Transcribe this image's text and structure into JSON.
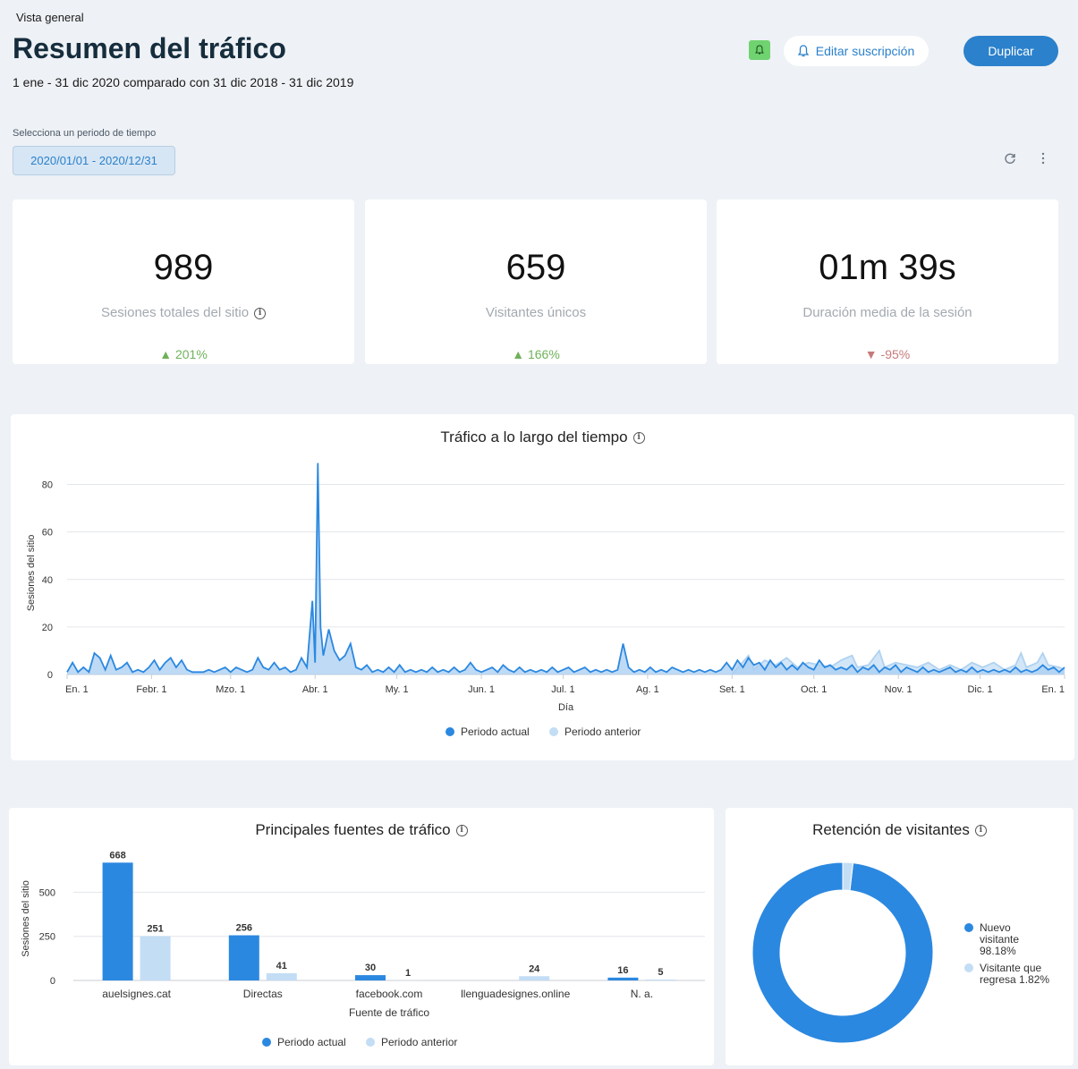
{
  "header": {
    "breadcrumb": "Vista general",
    "title": "Resumen del tráfico",
    "subtitle": "1 ene - 31 dic 2020 comparado con 31 dic 2018 - 31 dic 2019",
    "edit_subscription_label": "Editar suscripción",
    "duplicate_label": "Duplicar"
  },
  "period": {
    "label": "Selecciona un periodo de tiempo",
    "value": "2020/01/01 - 2020/12/31"
  },
  "kpis": [
    {
      "value": "989",
      "label": "Sesiones totales del sitio",
      "delta": "▲ 201%",
      "trend": "up"
    },
    {
      "value": "659",
      "label": "Visitantes únicos",
      "delta": "▲ 166%",
      "trend": "up"
    },
    {
      "value": "01m 39s",
      "label": "Duración media de la sesión",
      "delta": "▼ -95%",
      "trend": "down"
    }
  ],
  "colors": {
    "current": "#2b88e0",
    "previous": "#c3ddf5",
    "accent": "#2b81cb"
  },
  "chart_data": [
    {
      "type": "area",
      "title": "Tráfico a lo largo del tiempo",
      "xlabel": "Día",
      "ylabel": "Sesiones del sitio",
      "ylim": [
        0,
        90
      ],
      "yticks": [
        0,
        20,
        40,
        60,
        80
      ],
      "xticks": [
        "En. 1",
        "Febr. 1",
        "Mzo. 1",
        "Abr. 1",
        "My. 1",
        "Jun. 1",
        "Jul. 1",
        "Ag. 1",
        "Set. 1",
        "Oct. 1",
        "Nov. 1",
        "Dic. 1",
        "En. 1"
      ],
      "legend": "bottom",
      "series": [
        {
          "name": "Periodo actual",
          "points": [
            [
              0,
              1
            ],
            [
              2,
              5
            ],
            [
              4,
              1
            ],
            [
              6,
              3
            ],
            [
              8,
              1
            ],
            [
              10,
              9
            ],
            [
              12,
              7
            ],
            [
              14,
              2
            ],
            [
              16,
              8
            ],
            [
              18,
              2
            ],
            [
              20,
              3
            ],
            [
              22,
              5
            ],
            [
              24,
              1
            ],
            [
              26,
              2
            ],
            [
              28,
              1
            ],
            [
              30,
              3
            ],
            [
              32,
              6
            ],
            [
              34,
              2
            ],
            [
              36,
              5
            ],
            [
              38,
              7
            ],
            [
              40,
              3
            ],
            [
              42,
              6
            ],
            [
              44,
              2
            ],
            [
              46,
              1
            ],
            [
              48,
              1
            ],
            [
              50,
              1
            ],
            [
              52,
              2
            ],
            [
              54,
              1
            ],
            [
              56,
              2
            ],
            [
              58,
              3
            ],
            [
              60,
              1
            ],
            [
              62,
              3
            ],
            [
              64,
              2
            ],
            [
              66,
              1
            ],
            [
              68,
              2
            ],
            [
              70,
              7
            ],
            [
              72,
              3
            ],
            [
              74,
              2
            ],
            [
              76,
              5
            ],
            [
              78,
              2
            ],
            [
              80,
              3
            ],
            [
              82,
              1
            ],
            [
              84,
              2
            ],
            [
              86,
              7
            ],
            [
              88,
              3
            ],
            [
              90,
              31
            ],
            [
              91,
              5
            ],
            [
              92,
              89
            ],
            [
              93,
              20
            ],
            [
              94,
              8
            ],
            [
              96,
              19
            ],
            [
              98,
              10
            ],
            [
              100,
              6
            ],
            [
              102,
              8
            ],
            [
              104,
              13
            ],
            [
              106,
              3
            ],
            [
              108,
              2
            ],
            [
              110,
              4
            ],
            [
              112,
              1
            ],
            [
              114,
              2
            ],
            [
              116,
              1
            ],
            [
              118,
              3
            ],
            [
              120,
              1
            ],
            [
              122,
              4
            ],
            [
              124,
              1
            ],
            [
              126,
              2
            ],
            [
              128,
              1
            ],
            [
              130,
              2
            ],
            [
              132,
              1
            ],
            [
              134,
              3
            ],
            [
              136,
              1
            ],
            [
              138,
              2
            ],
            [
              140,
              1
            ],
            [
              142,
              3
            ],
            [
              144,
              1
            ],
            [
              146,
              2
            ],
            [
              148,
              5
            ],
            [
              150,
              2
            ],
            [
              152,
              1
            ],
            [
              154,
              2
            ],
            [
              156,
              3
            ],
            [
              158,
              1
            ],
            [
              160,
              4
            ],
            [
              162,
              2
            ],
            [
              164,
              1
            ],
            [
              166,
              3
            ],
            [
              168,
              1
            ],
            [
              170,
              2
            ],
            [
              172,
              1
            ],
            [
              174,
              2
            ],
            [
              176,
              1
            ],
            [
              178,
              3
            ],
            [
              180,
              1
            ],
            [
              182,
              2
            ],
            [
              184,
              3
            ],
            [
              186,
              1
            ],
            [
              188,
              2
            ],
            [
              190,
              3
            ],
            [
              192,
              1
            ],
            [
              194,
              2
            ],
            [
              196,
              1
            ],
            [
              198,
              2
            ],
            [
              200,
              1
            ],
            [
              202,
              2
            ],
            [
              204,
              13
            ],
            [
              206,
              3
            ],
            [
              208,
              1
            ],
            [
              210,
              2
            ],
            [
              212,
              1
            ],
            [
              214,
              3
            ],
            [
              216,
              1
            ],
            [
              218,
              2
            ],
            [
              220,
              1
            ],
            [
              222,
              3
            ],
            [
              224,
              2
            ],
            [
              226,
              1
            ],
            [
              228,
              2
            ],
            [
              230,
              1
            ],
            [
              232,
              2
            ],
            [
              234,
              1
            ],
            [
              236,
              2
            ],
            [
              238,
              1
            ],
            [
              240,
              2
            ],
            [
              242,
              5
            ],
            [
              244,
              2
            ],
            [
              246,
              6
            ],
            [
              248,
              3
            ],
            [
              250,
              7
            ],
            [
              252,
              4
            ],
            [
              254,
              5
            ],
            [
              256,
              2
            ],
            [
              258,
              6
            ],
            [
              260,
              3
            ],
            [
              262,
              5
            ],
            [
              264,
              2
            ],
            [
              266,
              4
            ],
            [
              268,
              2
            ],
            [
              270,
              5
            ],
            [
              272,
              3
            ],
            [
              274,
              2
            ],
            [
              276,
              6
            ],
            [
              278,
              3
            ],
            [
              280,
              4
            ],
            [
              282,
              2
            ],
            [
              284,
              3
            ],
            [
              286,
              2
            ],
            [
              288,
              4
            ],
            [
              290,
              1
            ],
            [
              292,
              3
            ],
            [
              294,
              2
            ],
            [
              296,
              4
            ],
            [
              298,
              1
            ],
            [
              300,
              3
            ],
            [
              302,
              2
            ],
            [
              304,
              4
            ],
            [
              306,
              1
            ],
            [
              308,
              3
            ],
            [
              310,
              2
            ],
            [
              312,
              1
            ],
            [
              314,
              3
            ],
            [
              316,
              1
            ],
            [
              318,
              2
            ],
            [
              320,
              1
            ],
            [
              322,
              2
            ],
            [
              324,
              3
            ],
            [
              326,
              1
            ],
            [
              328,
              2
            ],
            [
              330,
              1
            ],
            [
              332,
              3
            ],
            [
              334,
              1
            ],
            [
              336,
              2
            ],
            [
              338,
              1
            ],
            [
              340,
              2
            ],
            [
              342,
              1
            ],
            [
              344,
              2
            ],
            [
              346,
              1
            ],
            [
              348,
              3
            ],
            [
              350,
              1
            ],
            [
              352,
              2
            ],
            [
              354,
              1
            ],
            [
              356,
              2
            ],
            [
              358,
              4
            ],
            [
              360,
              2
            ],
            [
              362,
              3
            ],
            [
              364,
              1
            ],
            [
              366,
              3
            ]
          ]
        },
        {
          "name": "Periodo anterior",
          "points": [
            [
              244,
              0
            ],
            [
              250,
              8
            ],
            [
              252,
              2
            ],
            [
              256,
              6
            ],
            [
              260,
              4
            ],
            [
              264,
              7
            ],
            [
              268,
              3
            ],
            [
              272,
              5
            ],
            [
              276,
              4
            ],
            [
              280,
              3
            ],
            [
              284,
              6
            ],
            [
              288,
              8
            ],
            [
              290,
              3
            ],
            [
              294,
              4
            ],
            [
              298,
              10
            ],
            [
              300,
              3
            ],
            [
              304,
              5
            ],
            [
              308,
              4
            ],
            [
              312,
              3
            ],
            [
              316,
              5
            ],
            [
              320,
              2
            ],
            [
              324,
              4
            ],
            [
              328,
              2
            ],
            [
              332,
              5
            ],
            [
              336,
              3
            ],
            [
              340,
              5
            ],
            [
              344,
              2
            ],
            [
              348,
              4
            ],
            [
              350,
              9
            ],
            [
              352,
              3
            ],
            [
              356,
              5
            ],
            [
              358,
              9
            ],
            [
              360,
              4
            ],
            [
              364,
              3
            ],
            [
              366,
              2
            ]
          ]
        }
      ]
    },
    {
      "type": "bar",
      "title": "Principales fuentes de tráfico",
      "xlabel": "Fuente de tráfico",
      "ylabel": "Sesiones del sitio",
      "ylim": [
        0,
        700
      ],
      "yticks": [
        0,
        250,
        500
      ],
      "categories": [
        "auelsignes.cat",
        "Directas",
        "facebook.com",
        "llenguadesignes.online",
        "N. a."
      ],
      "legend": "bottom",
      "series": [
        {
          "name": "Periodo actual",
          "values": [
            668,
            256,
            30,
            null,
            16
          ]
        },
        {
          "name": "Periodo anterior",
          "values": [
            251,
            41,
            1,
            24,
            5
          ]
        }
      ]
    },
    {
      "type": "pie",
      "title": "Retención de visitantes",
      "legend": "right",
      "slices": [
        {
          "label": "Nuevo visitante",
          "value": 98.18,
          "display": "98.18%"
        },
        {
          "label": "Visitante que regresa",
          "value": 1.82,
          "display": "1.82%"
        }
      ]
    }
  ]
}
